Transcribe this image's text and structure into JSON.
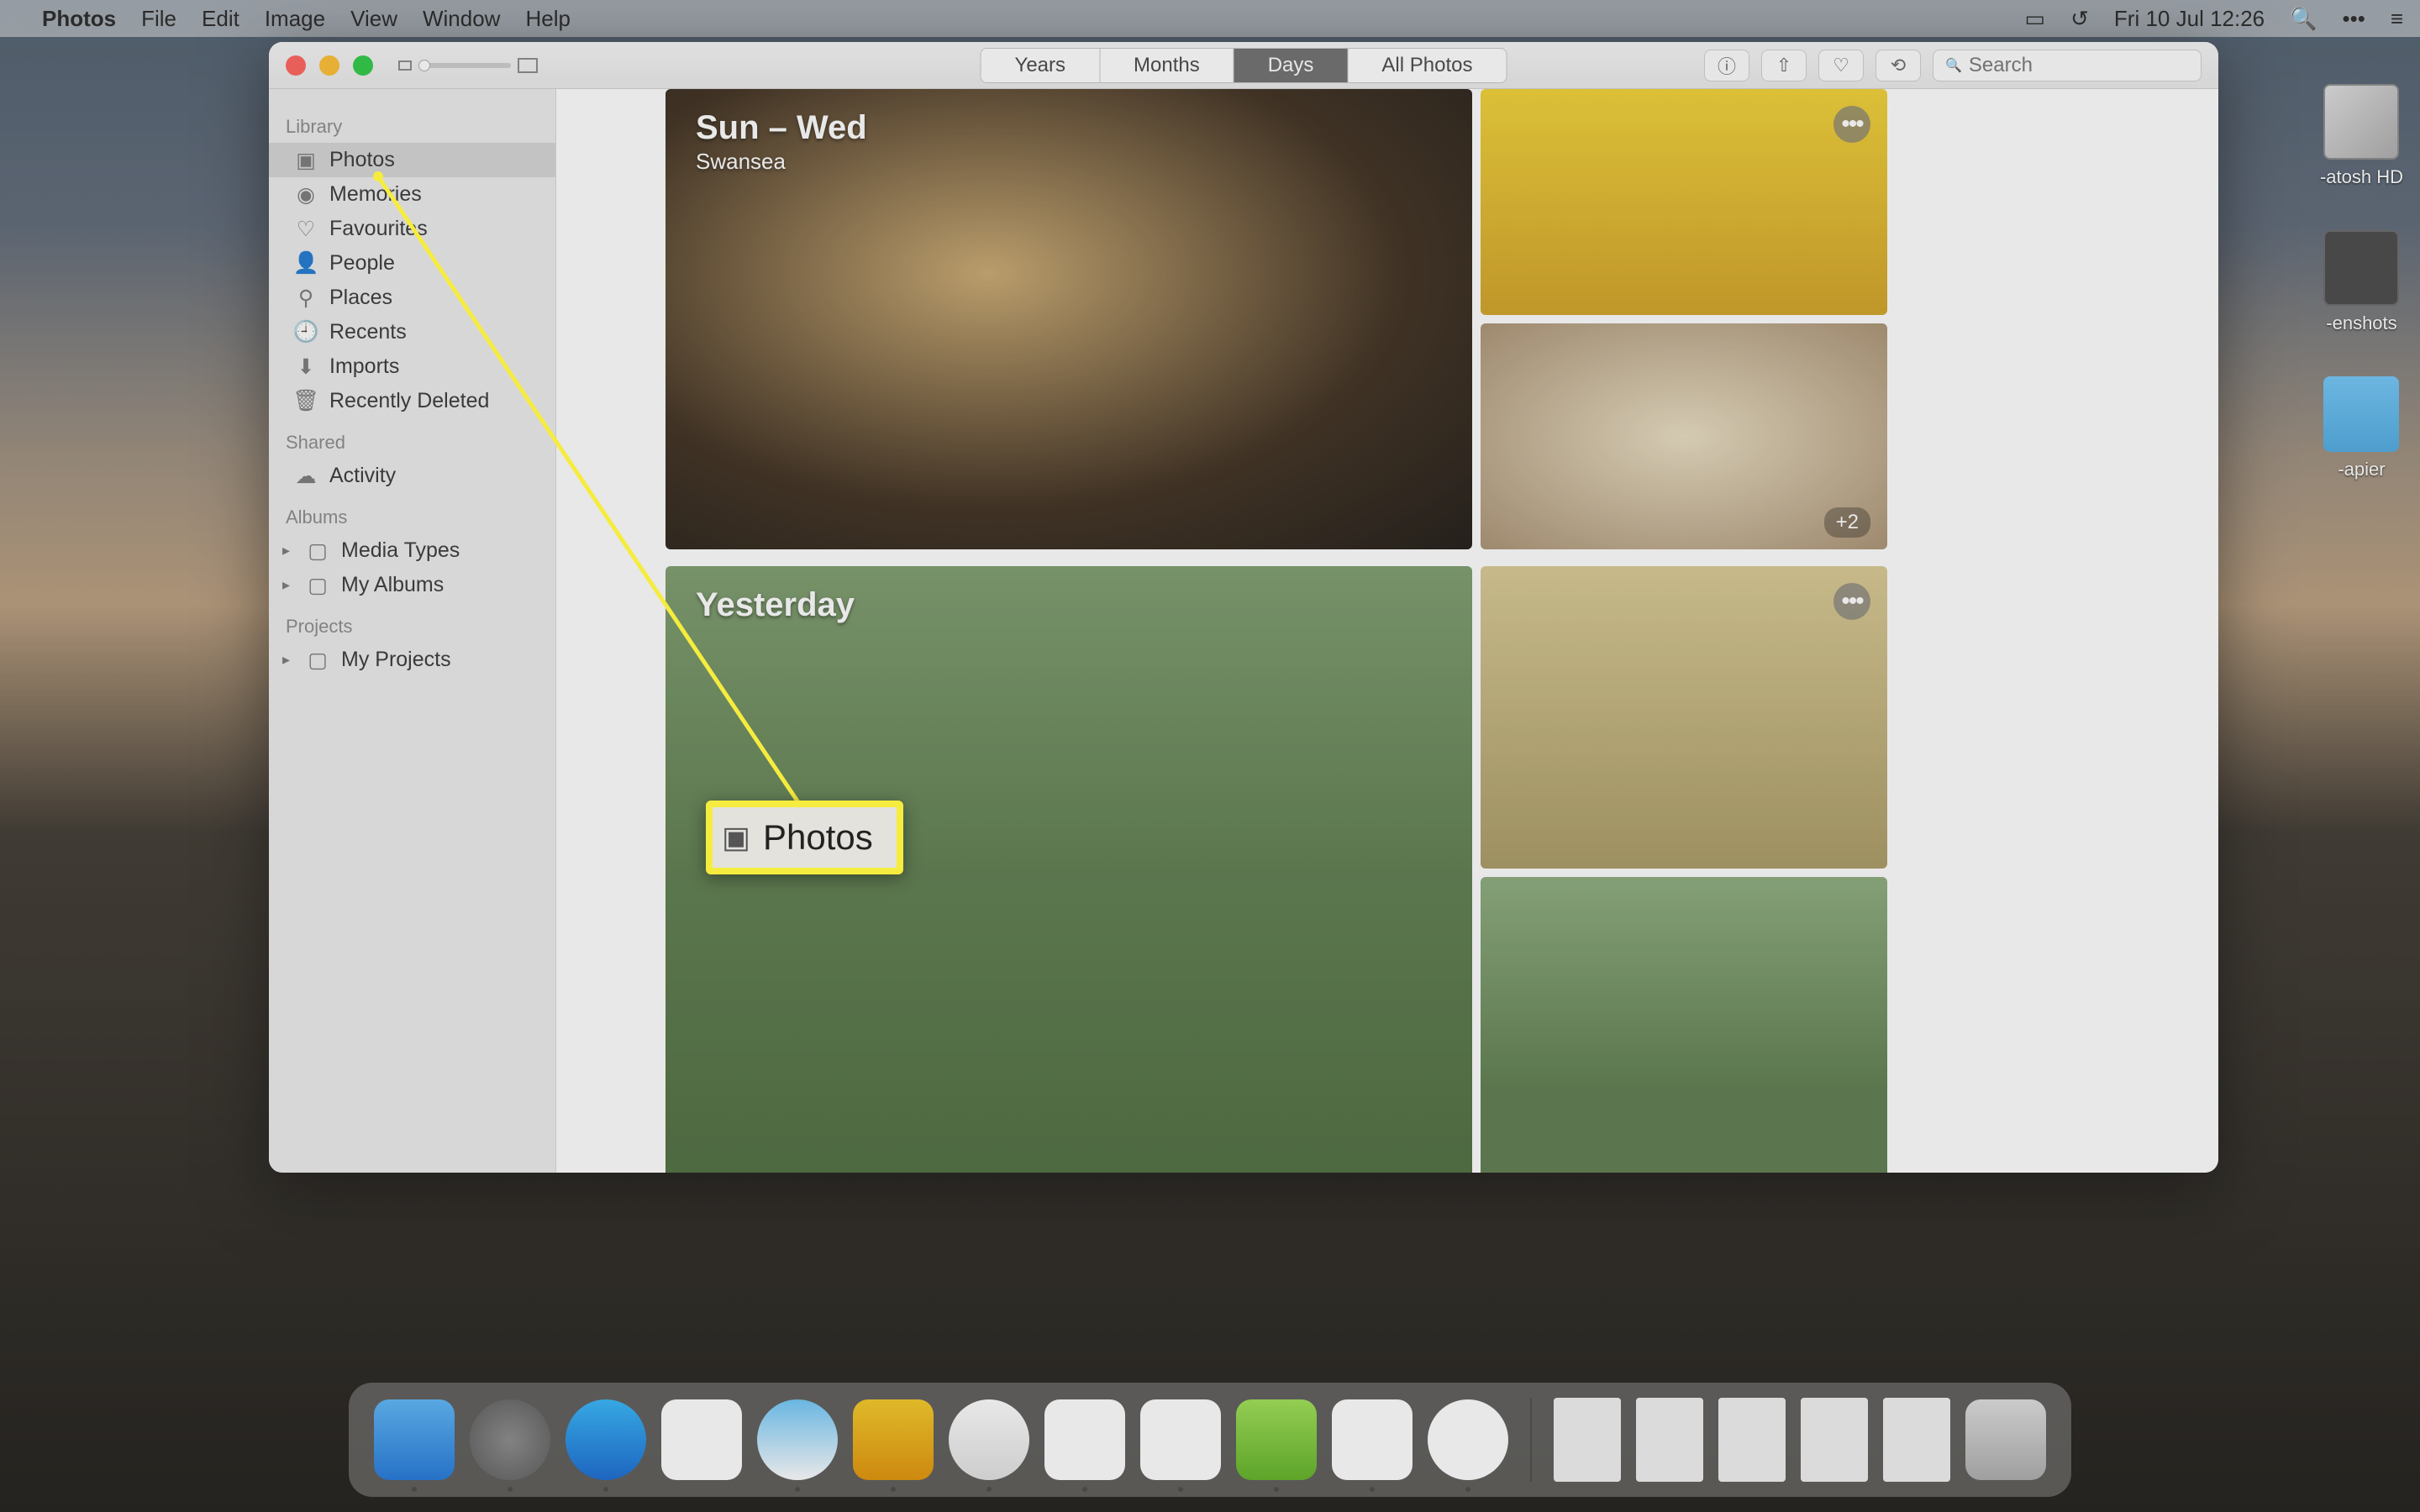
{
  "menubar": {
    "app": "Photos",
    "items": [
      "File",
      "Edit",
      "Image",
      "View",
      "Window",
      "Help"
    ],
    "datetime": "Fri 10 Jul  12:26"
  },
  "desktop": {
    "icons": [
      {
        "label": "-atosh HD"
      },
      {
        "label": "-enshots"
      },
      {
        "label": "-apier"
      }
    ]
  },
  "window": {
    "segments": [
      "Years",
      "Months",
      "Days",
      "All Photos"
    ],
    "active_segment": 2,
    "search_placeholder": "Search"
  },
  "sidebar": {
    "sections": [
      {
        "title": "Library",
        "items": [
          {
            "icon": "photos",
            "label": "Photos",
            "selected": true
          },
          {
            "icon": "memories",
            "label": "Memories"
          },
          {
            "icon": "heart",
            "label": "Favourites"
          },
          {
            "icon": "person",
            "label": "People"
          },
          {
            "icon": "places",
            "label": "Places"
          },
          {
            "icon": "recents",
            "label": "Recents"
          },
          {
            "icon": "imports",
            "label": "Imports"
          },
          {
            "icon": "trash",
            "label": "Recently Deleted"
          }
        ]
      },
      {
        "title": "Shared",
        "items": [
          {
            "icon": "cloud",
            "label": "Activity"
          }
        ]
      },
      {
        "title": "Albums",
        "items": [
          {
            "icon": "album",
            "label": "Media Types",
            "chevron": true
          },
          {
            "icon": "album",
            "label": "My Albums",
            "chevron": true
          }
        ]
      },
      {
        "title": "Projects",
        "items": [
          {
            "icon": "album",
            "label": "My Projects",
            "chevron": true
          }
        ]
      }
    ]
  },
  "days": [
    {
      "title": "Sun – Wed",
      "subtitle": "Swansea",
      "more_count": "+2"
    },
    {
      "title": "Yesterday",
      "subtitle": ""
    }
  ],
  "callout": {
    "label": "Photos"
  },
  "dock": {
    "running": [
      true,
      true,
      true,
      false,
      true,
      true,
      true,
      true,
      true,
      true,
      true,
      true
    ]
  }
}
